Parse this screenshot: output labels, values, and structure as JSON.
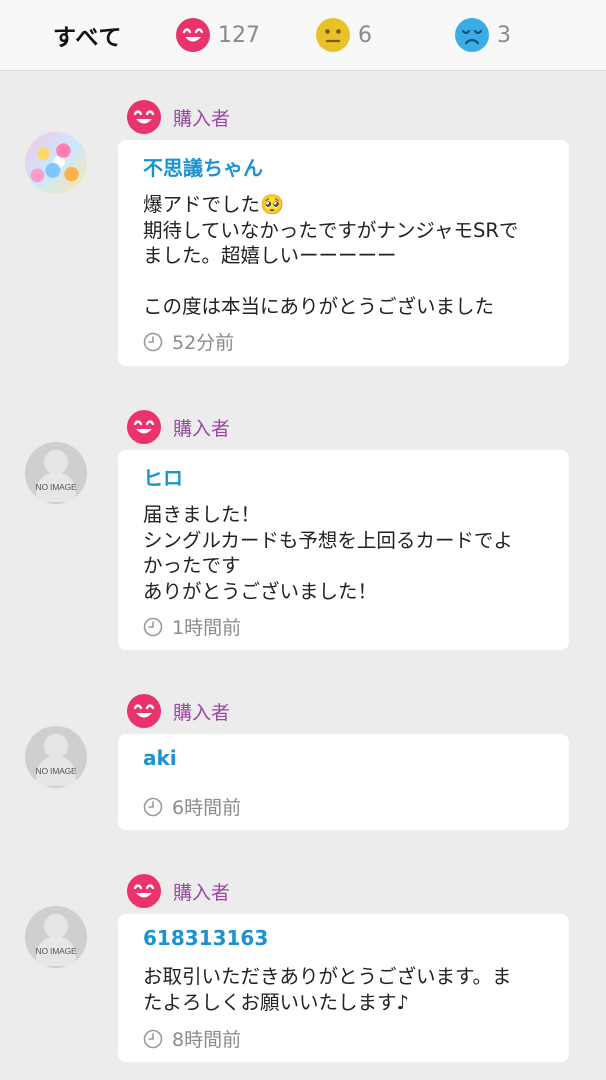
{
  "tabs": {
    "all_label": "すべて",
    "good_count": "127",
    "normal_count": "6",
    "bad_count": "3"
  },
  "colors": {
    "good": "#e8336b",
    "normal": "#e9c22a",
    "bad": "#3aaee4",
    "name": "#1c93d1",
    "role": "#9b4aa3"
  },
  "reviews": [
    {
      "role": "購入者",
      "avatar": "photo",
      "name": "不思議ちゃん",
      "message": "爆アドでした🥺\n期待していなかったですがナンジャモSRで\nました。超嬉しいーーーーー\n\nこの度は本当にありがとうございました",
      "time": "52分前"
    },
    {
      "role": "購入者",
      "avatar": "NO IMAGE",
      "name": "ヒロ",
      "message": "届きました！\nシングルカードも予想を上回るカードでよ\nかったです\nありがとうございました！",
      "time": "1時間前"
    },
    {
      "role": "購入者",
      "avatar": "NO IMAGE",
      "name": "aki",
      "message": "",
      "time": "6時間前"
    },
    {
      "role": "購入者",
      "avatar": "NO IMAGE",
      "name": "618313163",
      "message": "お取引いただきありがとうございます。ま\nたよろしくお願いいたします♪",
      "time": "8時間前"
    }
  ]
}
